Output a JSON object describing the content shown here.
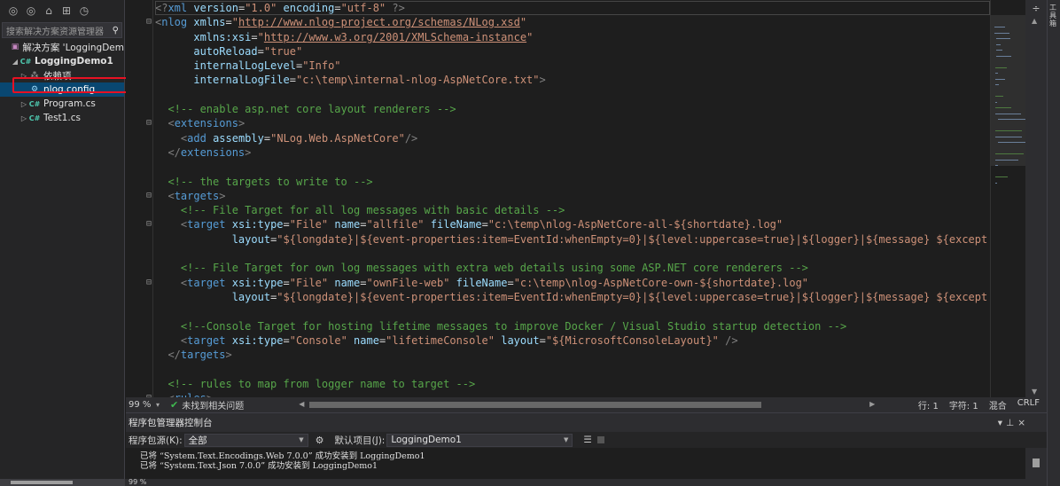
{
  "explorer": {
    "search_placeholder": "搜索解决方案资源管理器",
    "toolbar_icons": [
      "back-icon",
      "forward-icon",
      "home-icon",
      "solution-switch-icon",
      "history-icon"
    ],
    "items": [
      {
        "label": "解决方案 'LoggingDem",
        "level": 0,
        "icon": "solution-icon",
        "arrow": ""
      },
      {
        "label": "LoggingDemo1",
        "level": 1,
        "icon": "csharp-project-icon",
        "arrow": "◢"
      },
      {
        "label": "依赖项",
        "level": 2,
        "icon": "dependencies-icon",
        "arrow": "▷"
      },
      {
        "label": "nlog.config",
        "level": 2,
        "icon": "config-file-icon",
        "arrow": "",
        "selected": true
      },
      {
        "label": "Program.cs",
        "level": 2,
        "icon": "csharp-file-icon",
        "arrow": "▷"
      },
      {
        "label": "Test1.cs",
        "level": 2,
        "icon": "csharp-file-icon",
        "arrow": "▷"
      }
    ]
  },
  "editor": {
    "lines": [
      "<?xml version=\"1.0\" encoding=\"utf-8\" ?>",
      "<nlog xmlns=\"http://www.nlog-project.org/schemas/NLog.xsd\"",
      "      xmlns:xsi=\"http://www.w3.org/2001/XMLSchema-instance\"",
      "      autoReload=\"true\"",
      "      internalLogLevel=\"Info\"",
      "      internalLogFile=\"c:\\temp\\internal-nlog-AspNetCore.txt\">",
      "",
      "  <!-- enable asp.net core layout renderers -->",
      "  <extensions>",
      "    <add assembly=\"NLog.Web.AspNetCore\"/>",
      "  </extensions>",
      "",
      "  <!-- the targets to write to -->",
      "  <targets>",
      "    <!-- File Target for all log messages with basic details -->",
      "    <target xsi:type=\"File\" name=\"allfile\" fileName=\"c:\\temp\\nlog-AspNetCore-all-${shortdate}.log\"",
      "            layout=\"${longdate}|${event-properties:item=EventId:whenEmpty=0}|${level:uppercase=true}|${logger}|${message} ${except",
      "",
      "    <!-- File Target for own log messages with extra web details using some ASP.NET core renderers -->",
      "    <target xsi:type=\"File\" name=\"ownFile-web\" fileName=\"c:\\temp\\nlog-AspNetCore-own-${shortdate}.log\"",
      "            layout=\"${longdate}|${event-properties:item=EventId:whenEmpty=0}|${level:uppercase=true}|${logger}|${message} ${except",
      "",
      "    <!--Console Target for hosting lifetime messages to improve Docker / Visual Studio startup detection -->",
      "    <target xsi:type=\"Console\" name=\"lifetimeConsole\" layout=\"${MicrosoftConsoleLayout}\" />",
      "  </targets>",
      "",
      "  <!-- rules to map from logger name to target -->",
      "  <rules>"
    ]
  },
  "editor_status": {
    "zoom": "99 %",
    "issues": "未找到相关问题",
    "line": "行: 1",
    "char": "字符: 1",
    "mixed": "混合",
    "eol": "CRLF"
  },
  "console": {
    "title": "程序包管理器控制台",
    "source_label": "程序包源(K):",
    "source_value": "全部",
    "project_label": "默认项目(J):",
    "project_value": "LoggingDemo1",
    "output": [
      "已将 “System.Text.Encodings.Web 7.0.0” 成功安装到 LoggingDemo1",
      "已将 “System.Text.Json 7.0.0” 成功安装到 LoggingDemo1"
    ],
    "zoom": "99 %"
  },
  "right_strip": {
    "tab": "工具箱"
  }
}
